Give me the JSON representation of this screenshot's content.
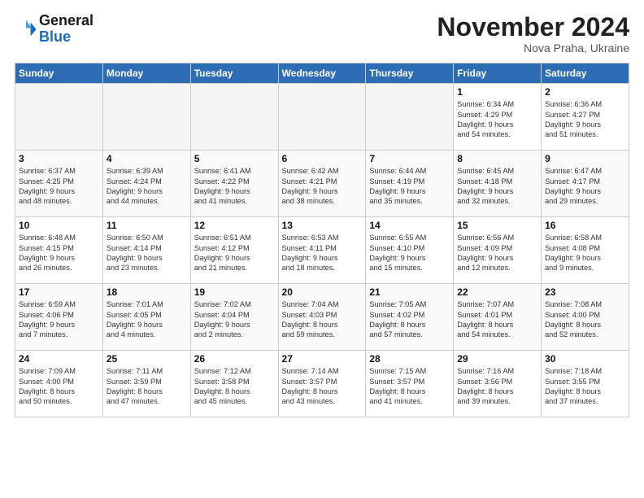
{
  "header": {
    "logo_line1": "General",
    "logo_line2": "Blue",
    "month": "November 2024",
    "location": "Nova Praha, Ukraine"
  },
  "weekdays": [
    "Sunday",
    "Monday",
    "Tuesday",
    "Wednesday",
    "Thursday",
    "Friday",
    "Saturday"
  ],
  "weeks": [
    [
      {
        "day": "",
        "info": ""
      },
      {
        "day": "",
        "info": ""
      },
      {
        "day": "",
        "info": ""
      },
      {
        "day": "",
        "info": ""
      },
      {
        "day": "",
        "info": ""
      },
      {
        "day": "1",
        "info": "Sunrise: 6:34 AM\nSunset: 4:29 PM\nDaylight: 9 hours\nand 54 minutes."
      },
      {
        "day": "2",
        "info": "Sunrise: 6:36 AM\nSunset: 4:27 PM\nDaylight: 9 hours\nand 51 minutes."
      }
    ],
    [
      {
        "day": "3",
        "info": "Sunrise: 6:37 AM\nSunset: 4:25 PM\nDaylight: 9 hours\nand 48 minutes."
      },
      {
        "day": "4",
        "info": "Sunrise: 6:39 AM\nSunset: 4:24 PM\nDaylight: 9 hours\nand 44 minutes."
      },
      {
        "day": "5",
        "info": "Sunrise: 6:41 AM\nSunset: 4:22 PM\nDaylight: 9 hours\nand 41 minutes."
      },
      {
        "day": "6",
        "info": "Sunrise: 6:42 AM\nSunset: 4:21 PM\nDaylight: 9 hours\nand 38 minutes."
      },
      {
        "day": "7",
        "info": "Sunrise: 6:44 AM\nSunset: 4:19 PM\nDaylight: 9 hours\nand 35 minutes."
      },
      {
        "day": "8",
        "info": "Sunrise: 6:45 AM\nSunset: 4:18 PM\nDaylight: 9 hours\nand 32 minutes."
      },
      {
        "day": "9",
        "info": "Sunrise: 6:47 AM\nSunset: 4:17 PM\nDaylight: 9 hours\nand 29 minutes."
      }
    ],
    [
      {
        "day": "10",
        "info": "Sunrise: 6:48 AM\nSunset: 4:15 PM\nDaylight: 9 hours\nand 26 minutes."
      },
      {
        "day": "11",
        "info": "Sunrise: 6:50 AM\nSunset: 4:14 PM\nDaylight: 9 hours\nand 23 minutes."
      },
      {
        "day": "12",
        "info": "Sunrise: 6:51 AM\nSunset: 4:12 PM\nDaylight: 9 hours\nand 21 minutes."
      },
      {
        "day": "13",
        "info": "Sunrise: 6:53 AM\nSunset: 4:11 PM\nDaylight: 9 hours\nand 18 minutes."
      },
      {
        "day": "14",
        "info": "Sunrise: 6:55 AM\nSunset: 4:10 PM\nDaylight: 9 hours\nand 15 minutes."
      },
      {
        "day": "15",
        "info": "Sunrise: 6:56 AM\nSunset: 4:09 PM\nDaylight: 9 hours\nand 12 minutes."
      },
      {
        "day": "16",
        "info": "Sunrise: 6:58 AM\nSunset: 4:08 PM\nDaylight: 9 hours\nand 9 minutes."
      }
    ],
    [
      {
        "day": "17",
        "info": "Sunrise: 6:59 AM\nSunset: 4:06 PM\nDaylight: 9 hours\nand 7 minutes."
      },
      {
        "day": "18",
        "info": "Sunrise: 7:01 AM\nSunset: 4:05 PM\nDaylight: 9 hours\nand 4 minutes."
      },
      {
        "day": "19",
        "info": "Sunrise: 7:02 AM\nSunset: 4:04 PM\nDaylight: 9 hours\nand 2 minutes."
      },
      {
        "day": "20",
        "info": "Sunrise: 7:04 AM\nSunset: 4:03 PM\nDaylight: 8 hours\nand 59 minutes."
      },
      {
        "day": "21",
        "info": "Sunrise: 7:05 AM\nSunset: 4:02 PM\nDaylight: 8 hours\nand 57 minutes."
      },
      {
        "day": "22",
        "info": "Sunrise: 7:07 AM\nSunset: 4:01 PM\nDaylight: 8 hours\nand 54 minutes."
      },
      {
        "day": "23",
        "info": "Sunrise: 7:08 AM\nSunset: 4:00 PM\nDaylight: 8 hours\nand 52 minutes."
      }
    ],
    [
      {
        "day": "24",
        "info": "Sunrise: 7:09 AM\nSunset: 4:00 PM\nDaylight: 8 hours\nand 50 minutes."
      },
      {
        "day": "25",
        "info": "Sunrise: 7:11 AM\nSunset: 3:59 PM\nDaylight: 8 hours\nand 47 minutes."
      },
      {
        "day": "26",
        "info": "Sunrise: 7:12 AM\nSunset: 3:58 PM\nDaylight: 8 hours\nand 45 minutes."
      },
      {
        "day": "27",
        "info": "Sunrise: 7:14 AM\nSunset: 3:57 PM\nDaylight: 8 hours\nand 43 minutes."
      },
      {
        "day": "28",
        "info": "Sunrise: 7:15 AM\nSunset: 3:57 PM\nDaylight: 8 hours\nand 41 minutes."
      },
      {
        "day": "29",
        "info": "Sunrise: 7:16 AM\nSunset: 3:56 PM\nDaylight: 8 hours\nand 39 minutes."
      },
      {
        "day": "30",
        "info": "Sunrise: 7:18 AM\nSunset: 3:55 PM\nDaylight: 8 hours\nand 37 minutes."
      }
    ]
  ]
}
